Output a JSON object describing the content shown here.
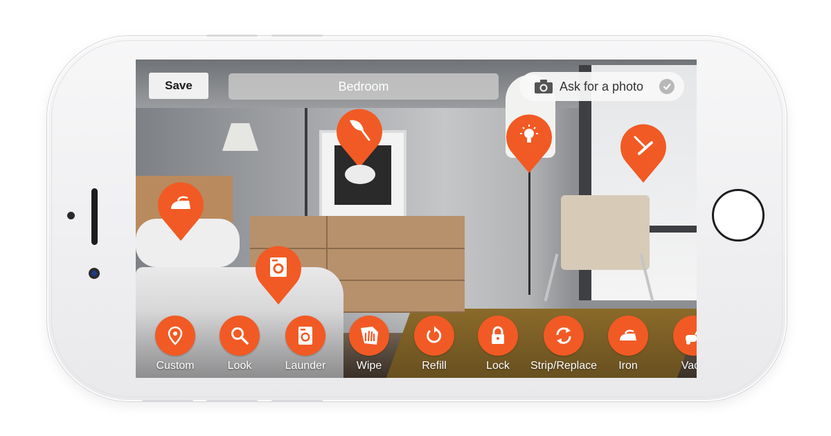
{
  "accent_color": "#f15a24",
  "header": {
    "save_label": "Save",
    "room_name": "Bedroom",
    "ask_photo_label": "Ask for a photo",
    "ask_photo_icon": "camera-icon",
    "ask_photo_status_icon": "check-circle-icon"
  },
  "pins": [
    {
      "name": "duster",
      "icon": "duster-icon"
    },
    {
      "name": "light",
      "icon": "lightbulb-icon"
    },
    {
      "name": "squeegee",
      "icon": "squeegee-icon"
    },
    {
      "name": "iron",
      "icon": "iron-icon"
    },
    {
      "name": "launder",
      "icon": "washing-machine-icon"
    }
  ],
  "toolbar": {
    "items": [
      {
        "label": "Custom",
        "icon": "map-pin-icon"
      },
      {
        "label": "Look",
        "icon": "magnifier-icon"
      },
      {
        "label": "Launder",
        "icon": "washing-machine-icon"
      },
      {
        "label": "Wipe",
        "icon": "glove-icon"
      },
      {
        "label": "Refill",
        "icon": "refill-arrow-icon"
      },
      {
        "label": "Lock",
        "icon": "padlock-icon"
      },
      {
        "label": "Strip/Replace",
        "icon": "cycle-arrows-icon"
      },
      {
        "label": "Iron",
        "icon": "iron-icon"
      },
      {
        "label": "Vacc",
        "icon": "vacuum-icon"
      }
    ]
  }
}
